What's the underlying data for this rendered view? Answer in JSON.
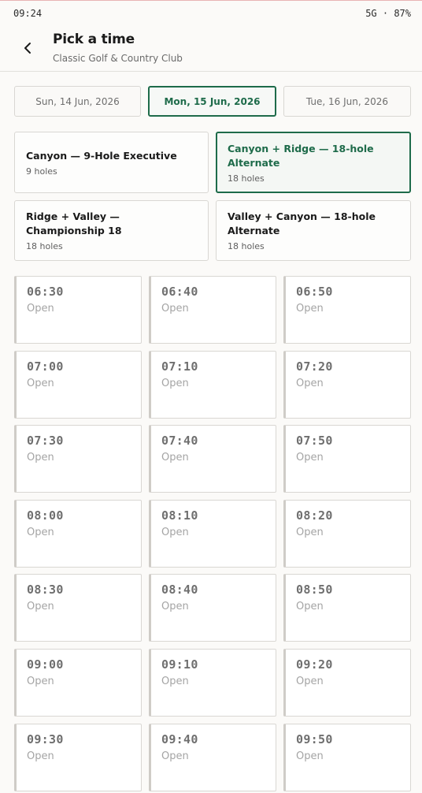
{
  "status_bar": {
    "time": "09:24",
    "right": "5G · 87%"
  },
  "header": {
    "title": "Pick a time",
    "subtitle": "Classic Golf & Country Club"
  },
  "dates": [
    {
      "label": "Sun, 14 Jun, 2026",
      "selected": false
    },
    {
      "label": "Mon, 15 Jun, 2026",
      "selected": true
    },
    {
      "label": "Tue, 16 Jun, 2026",
      "selected": false
    }
  ],
  "courses": [
    {
      "name": "Canyon — 9-Hole Executive",
      "holes": "9 holes",
      "selected": false
    },
    {
      "name": "Canyon + Ridge — 18-hole Alternate",
      "holes": "18 holes",
      "selected": true
    },
    {
      "name": "Ridge + Valley — Championship 18",
      "holes": "18 holes",
      "selected": false
    },
    {
      "name": "Valley + Canyon — 18-hole Alternate",
      "holes": "18 holes",
      "selected": false
    }
  ],
  "slots": [
    {
      "time": "06:30",
      "status": "Open"
    },
    {
      "time": "06:40",
      "status": "Open"
    },
    {
      "time": "06:50",
      "status": "Open"
    },
    {
      "time": "07:00",
      "status": "Open"
    },
    {
      "time": "07:10",
      "status": "Open"
    },
    {
      "time": "07:20",
      "status": "Open"
    },
    {
      "time": "07:30",
      "status": "Open"
    },
    {
      "time": "07:40",
      "status": "Open"
    },
    {
      "time": "07:50",
      "status": "Open"
    },
    {
      "time": "08:00",
      "status": "Open"
    },
    {
      "time": "08:10",
      "status": "Open"
    },
    {
      "time": "08:20",
      "status": "Open"
    },
    {
      "time": "08:30",
      "status": "Open"
    },
    {
      "time": "08:40",
      "status": "Open"
    },
    {
      "time": "08:50",
      "status": "Open"
    },
    {
      "time": "09:00",
      "status": "Open"
    },
    {
      "time": "09:10",
      "status": "Open"
    },
    {
      "time": "09:20",
      "status": "Open"
    },
    {
      "time": "09:30",
      "status": "Open"
    },
    {
      "time": "09:40",
      "status": "Open"
    },
    {
      "time": "09:50",
      "status": "Open"
    }
  ],
  "colors": {
    "accent": "#1e6b4a",
    "border": "#d9d7d3",
    "muted": "#a4a4a4"
  },
  "icons": {
    "back": "chevron-left-icon"
  }
}
